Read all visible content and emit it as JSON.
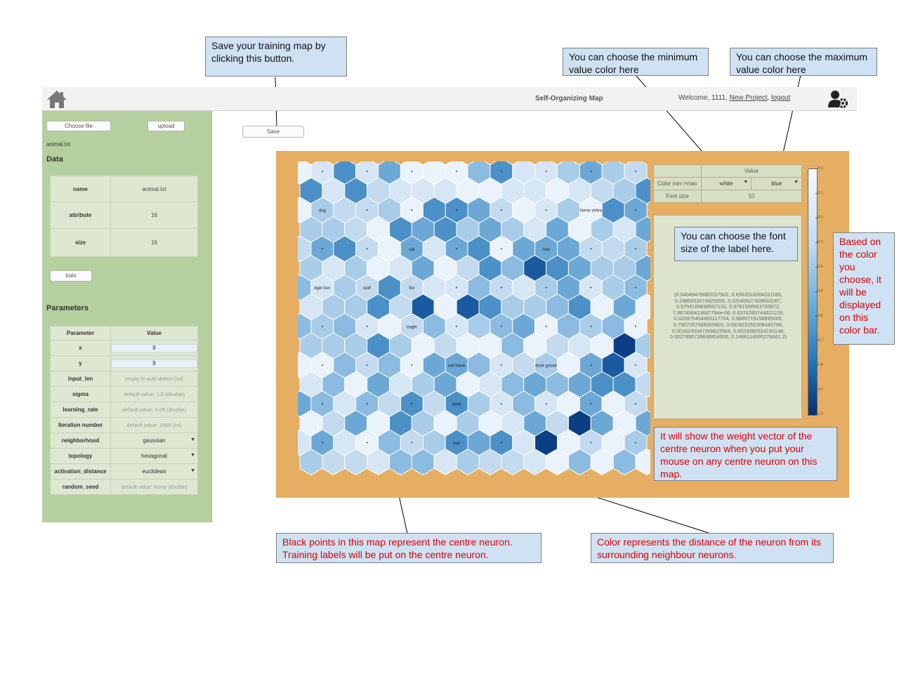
{
  "nav": {
    "title": "Self-Organizing Map",
    "welcome_prefix": "Welcome, 1111,",
    "new_project": "New Project",
    "sep": ",",
    "logout": "logout"
  },
  "left": {
    "choose_file": "Choose file",
    "upload": "upload",
    "file_name": "animal.txt",
    "data_title": "Data",
    "data_rows": [
      {
        "label": "name",
        "value": "animal.txt"
      },
      {
        "label": "attribute",
        "value": "16"
      },
      {
        "label": "size",
        "value": "16"
      }
    ],
    "train": "train",
    "params_title": "Parameters",
    "param_header": {
      "label": "Parameter",
      "value": "Value"
    },
    "params": [
      {
        "label": "x",
        "value": "8",
        "kind": "input"
      },
      {
        "label": "y",
        "value": "8",
        "kind": "input"
      },
      {
        "label": "input_len",
        "value": "empty to auto detect (int)",
        "kind": "placeholder"
      },
      {
        "label": "sigma",
        "value": "default value: 1.5 (double)",
        "kind": "placeholder"
      },
      {
        "label": "learning_rate",
        "value": "default value: 0.05 (double)",
        "kind": "placeholder"
      },
      {
        "label": "Iteration number",
        "value": "default value: 1000 (int)",
        "kind": "placeholder"
      },
      {
        "label": "neighborhood",
        "value": "gaussian",
        "kind": "select"
      },
      {
        "label": "topology",
        "value": "hexagonal",
        "kind": "select"
      },
      {
        "label": "activation_distance",
        "value": "euclidean",
        "kind": "select"
      },
      {
        "label": "random_seed",
        "value": "default value: None (double)",
        "kind": "placeholder"
      }
    ]
  },
  "save_label": "Save",
  "settings": {
    "header": "Value",
    "color_label": "Color min->max",
    "min_color": "white",
    "max_color": "blue",
    "font_label": "Font size",
    "font_value": "10"
  },
  "vector_text": "(0.04049479683157902, 0.6563318264221185, 0.2989352474925555, 0.02045627409933287, 0.9754106899507133, 0.9761558563765672, 7.987456413687794e-06, 0.6376285744821218, 0.020975404465117704, 0.9889719158895005, 0.7907257598650803, 0.002822255308445789, 0.0016230047269623564, 0.6529380524150148, 0.0027855728838854506, 0.1466114695276461 2)",
  "colorbar_ticks": [
    "0.0",
    "0.1",
    "0.2",
    "0.3",
    "0.4",
    "0.5",
    "0.6",
    "0.7",
    "0.8",
    "0.9",
    "1.0"
  ],
  "colors": {
    "min": "#f7fbff",
    "max": "#08306b",
    "panel": "#e5ae62",
    "sidebar": "#b5cf9e"
  },
  "map_labels": [
    {
      "row": 2,
      "col": 1,
      "text": "dog"
    },
    {
      "row": 2,
      "col": 13,
      "text": "horse zebra"
    },
    {
      "row": 4,
      "col": 1,
      "text": ""
    },
    {
      "row": 4,
      "col": 5,
      "text": "cat"
    },
    {
      "row": 4,
      "col": 11,
      "text": "cow"
    },
    {
      "row": 6,
      "col": 1,
      "text": "tiger lion"
    },
    {
      "row": 6,
      "col": 3,
      "text": "wolf"
    },
    {
      "row": 6,
      "col": 5,
      "text": "fox"
    },
    {
      "row": 8,
      "col": 5,
      "text": "eagle"
    },
    {
      "row": 10,
      "col": 7,
      "text": "owl hawk"
    },
    {
      "row": 10,
      "col": 11,
      "text": "duck goose"
    },
    {
      "row": 12,
      "col": 7,
      "text": "dove"
    },
    {
      "row": 14,
      "col": 7,
      "text": "hen"
    }
  ],
  "callouts": {
    "save": "Save your training map by clicking this button.",
    "min_color": "You can choose the minimum value color here",
    "max_color": "You can choose the maximum value color here",
    "font": "You can choose the font size of the label here.",
    "colorbar": "Based on the color you choose, it will be displayed on this color bar.",
    "vector": "It will show the weight vector of the centre neuron when you put your mouse on any centre neuron on this map.",
    "black_points": "Black points in this map represent the centre neuron. Training labels will be put on the centre neuron.",
    "color_distance": "Color represents the distance of the neuron from its surrounding neighbour neurons."
  }
}
